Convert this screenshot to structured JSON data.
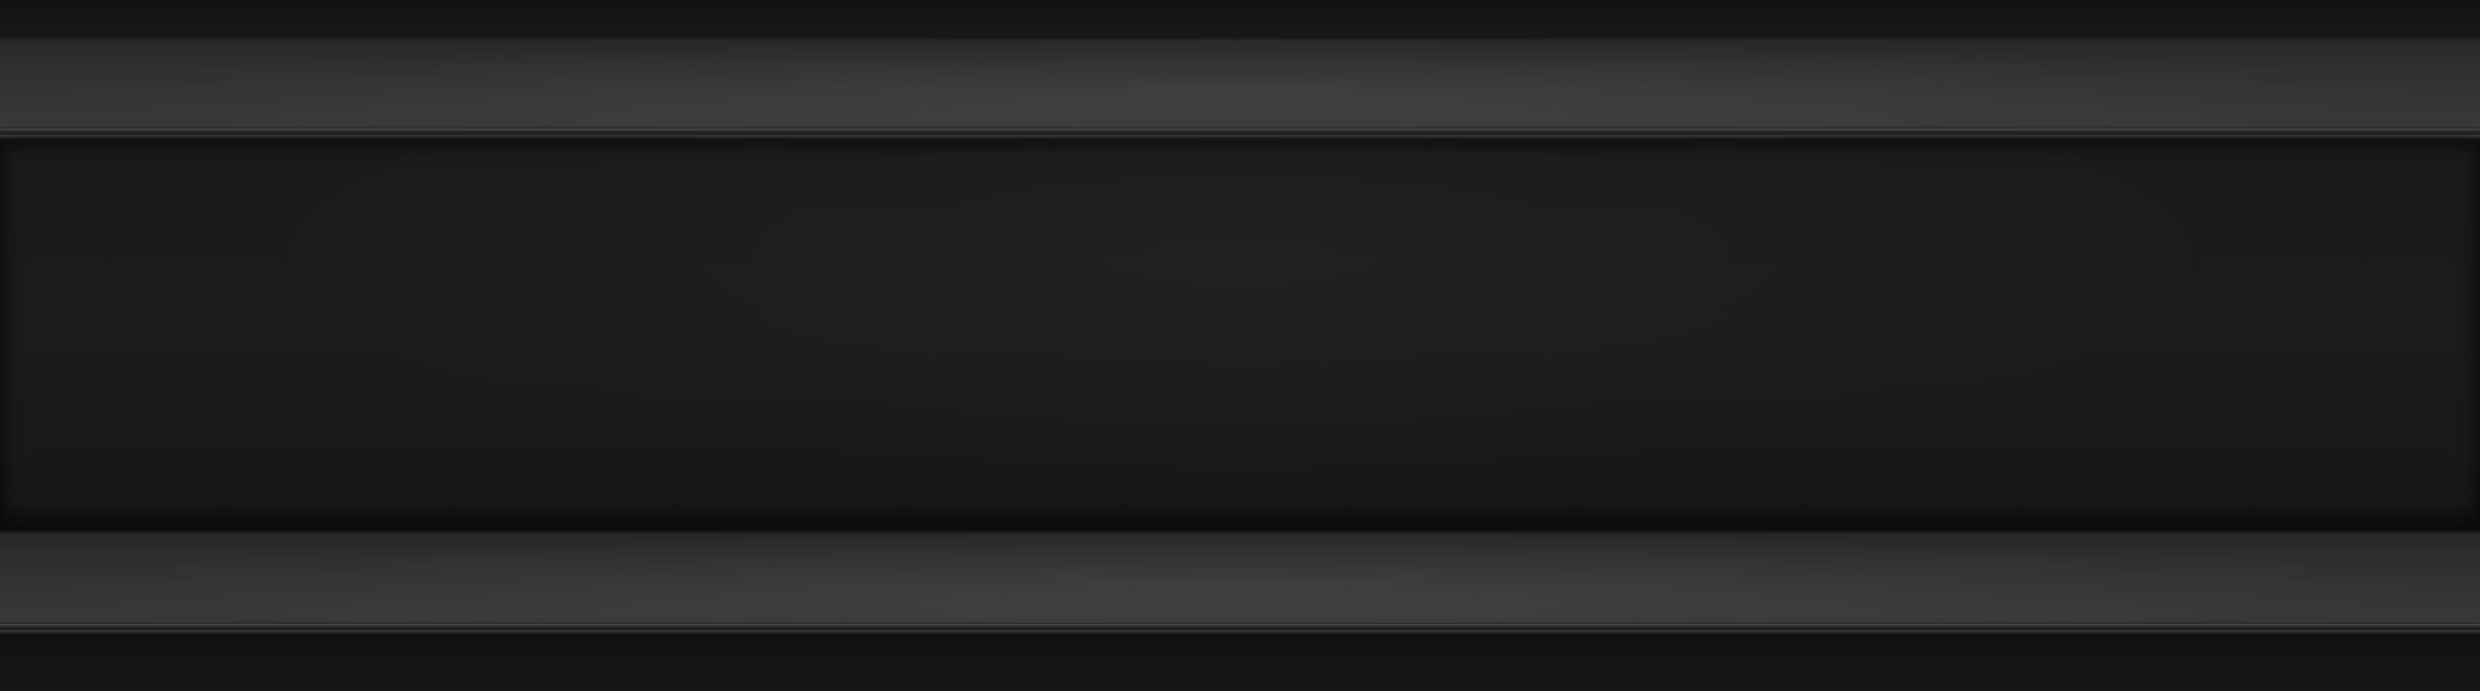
{
  "screen": {
    "description_visible_text": [],
    "colors": {
      "background": "#161616",
      "shelf_light": "#3a3a3a",
      "shelf_dark": "#262626",
      "panel": "#1a1a1a"
    }
  }
}
